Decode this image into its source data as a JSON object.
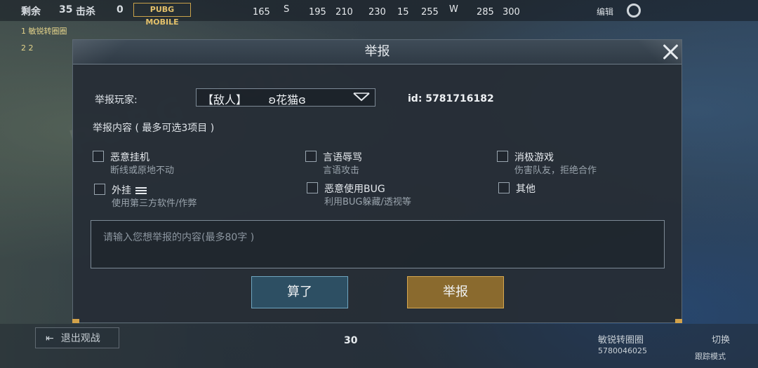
{
  "hud": {
    "remaining_label": "剩余",
    "remaining_count": "35",
    "kills_label": "击杀",
    "kills_count": "0",
    "logo": "PUBG MOBILE",
    "compass": [
      "165",
      "S",
      "195",
      "210",
      "230",
      "15",
      "255",
      "W",
      "285",
      "300"
    ],
    "top_right_label": "编辑",
    "feed": [
      "1 敏锐转圈圈",
      "2 2"
    ],
    "exit_label": "退出观战",
    "ammo": "30",
    "bottom_right": [
      "敏锐转圈圈",
      "5780046025",
      "切换",
      "跟踪模式"
    ]
  },
  "dialog": {
    "title": "举报",
    "player_label": "举报玩家:",
    "player_select": "【敌人】      ʚ花猫ɞ",
    "player_id": "id: 5781716182",
    "content_label": "举报内容 ( 最多可选3项目 )",
    "options": [
      {
        "title": "恶意挂机",
        "desc": "断线或原地不动"
      },
      {
        "title": "言语辱骂",
        "desc": "言语攻击"
      },
      {
        "title": "消极游戏",
        "desc": "伤害队友，拒绝合作"
      },
      {
        "title": "外挂",
        "desc": "使用第三方软件/作弊"
      },
      {
        "title": "恶意使用BUG",
        "desc": "利用BUG躲藏/透视等"
      },
      {
        "title": "其他",
        "desc": ""
      }
    ],
    "textarea_placeholder": "请输入您想举报的内容(最多80字 )",
    "cancel_label": "算了",
    "submit_label": "举报"
  },
  "colors": {
    "accent_gold": "#d6a850",
    "cancel_blue": "#2d4f63"
  }
}
